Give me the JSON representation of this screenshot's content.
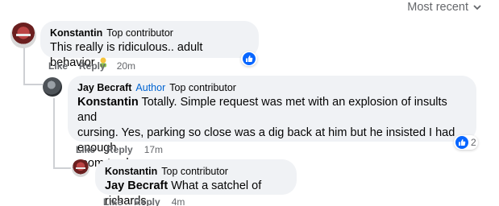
{
  "sort": {
    "label": "Most recent"
  },
  "comments": [
    {
      "author": "Konstantin",
      "badge": "Top contributor",
      "text": "This really is ridiculous.. adult behavior",
      "like": "Like",
      "reply": "Reply",
      "time": "20m",
      "reaction_icon": "like-icon"
    },
    {
      "author": "Jay Becraft",
      "author_tag": "Author",
      "badge": "Top contributor",
      "mention": "Konstantin",
      "text_line1": " Totally. Simple request was met with an explosion of insults and",
      "text_line2": "cursing. Yes, parking so close was a dig back at him but he insisted I had enough",
      "text_line3": "room to charge.",
      "like": "Like",
      "reply": "Reply",
      "time": "17m",
      "reaction_count": "2",
      "reaction_icon": "like-icon"
    },
    {
      "author": "Konstantin",
      "badge": "Top contributor",
      "mention": "Jay Becraft",
      "text": " What a satchel of richards..",
      "like": "Like",
      "reply": "Reply",
      "time": "4m"
    }
  ],
  "colors": {
    "bubble": "#f0f2f5",
    "like_blue": "#0866ff",
    "author_tag": "#0064d1"
  }
}
